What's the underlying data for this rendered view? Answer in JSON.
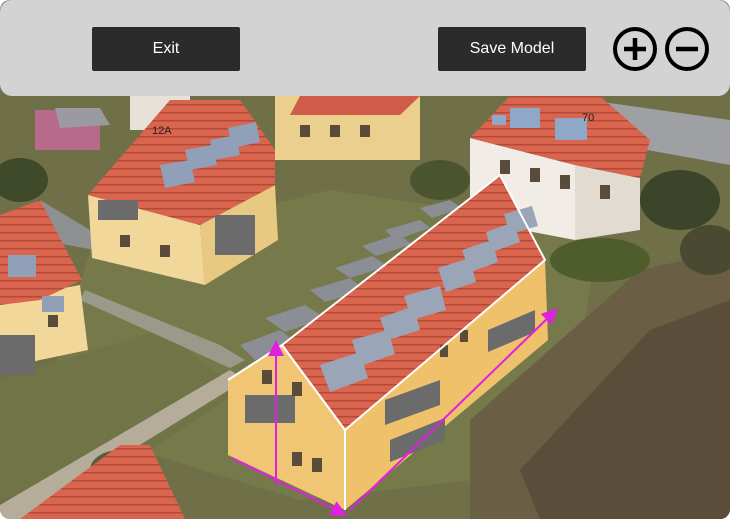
{
  "toolbar": {
    "exit_label": "Exit",
    "save_label": "Save Model",
    "zoom_in_icon": "plus-circle-icon",
    "zoom_out_icon": "minus-circle-icon"
  },
  "map": {
    "house_numbers": [
      "12A",
      "70"
    ],
    "outline_color": "#ffffff",
    "measure_color": "#e020e0"
  }
}
